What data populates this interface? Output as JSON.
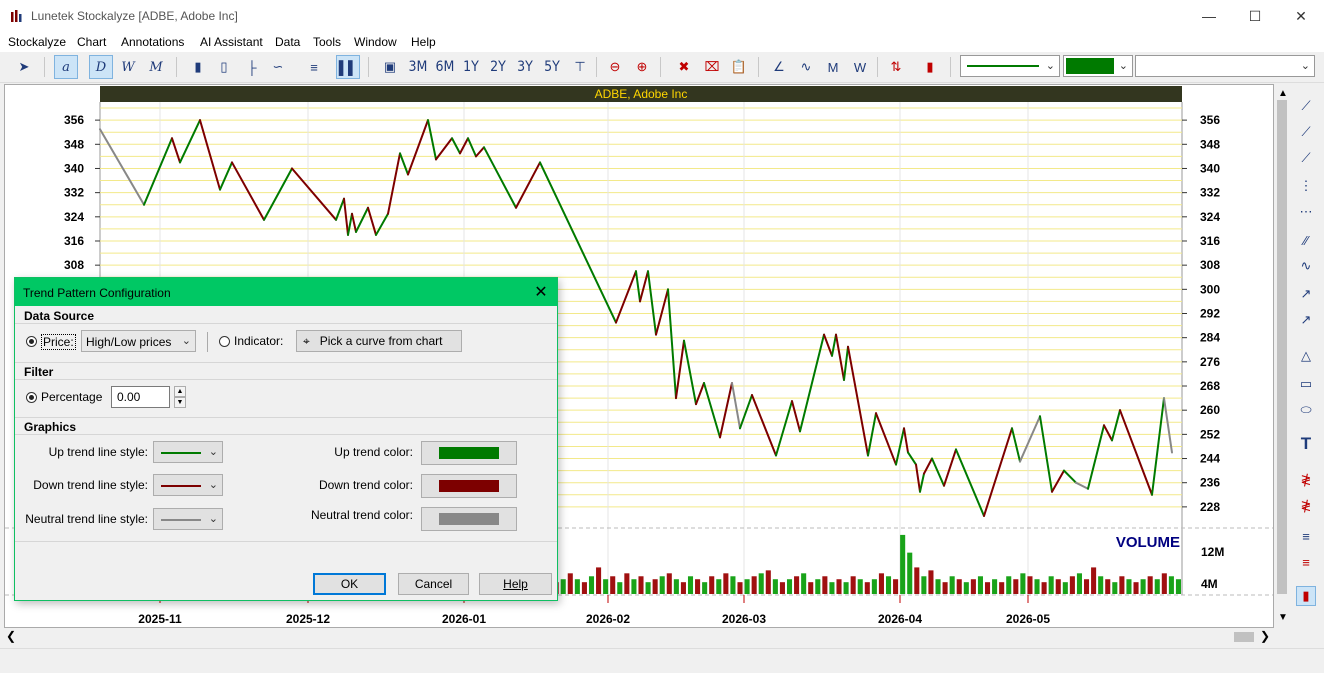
{
  "window": {
    "title": "Lunetek Stockalyze [ADBE, Adobe Inc]"
  },
  "menu": [
    "Stockalyze",
    "Chart",
    "Annotations",
    "AI Assistant",
    "Data",
    "Tools",
    "Window",
    "Help"
  ],
  "toolbar": {
    "periods": [
      "3M",
      "6M",
      "1Y",
      "2Y",
      "3Y",
      "5Y"
    ]
  },
  "chart_data": {
    "type": "line",
    "title": "ADBE, Adobe Inc",
    "ylim": [
      222,
      362
    ],
    "yticks": [
      356,
      348,
      340,
      332,
      324,
      316,
      308,
      300,
      292,
      284,
      276,
      268,
      260,
      252,
      244,
      236,
      228
    ],
    "xlabels": [
      "2025-11",
      "2025-12",
      "2026-01",
      "2026-02",
      "2026-03",
      "2026-04",
      "2026-05"
    ],
    "x_tick_positions_days": [
      15,
      52,
      91,
      127,
      161,
      200,
      232
    ],
    "volume_label": "VOLUME",
    "volume_ticks": [
      "12M",
      "4M"
    ],
    "volume_ylim": [
      0,
      22
    ],
    "trend_points": [
      [
        0,
        353
      ],
      [
        11,
        328
      ],
      [
        18,
        350
      ],
      [
        20,
        342
      ],
      [
        25,
        356
      ],
      [
        30,
        333
      ],
      [
        33,
        342
      ],
      [
        41,
        323
      ],
      [
        48,
        340
      ],
      [
        59,
        323
      ],
      [
        61,
        330
      ],
      [
        62,
        318
      ],
      [
        63,
        325
      ],
      [
        64,
        319
      ],
      [
        67,
        327
      ],
      [
        69,
        318
      ],
      [
        72,
        325
      ],
      [
        75,
        345
      ],
      [
        77,
        338
      ],
      [
        82,
        356
      ],
      [
        84,
        343
      ],
      [
        88,
        350
      ],
      [
        90,
        345
      ],
      [
        92,
        350
      ],
      [
        94,
        344
      ],
      [
        96,
        347
      ],
      [
        104,
        327
      ],
      [
        110,
        342
      ],
      [
        129,
        289
      ],
      [
        134,
        306
      ],
      [
        135,
        296
      ],
      [
        137,
        306
      ],
      [
        139,
        285
      ],
      [
        142,
        300
      ],
      [
        144,
        264
      ],
      [
        146,
        283
      ],
      [
        149,
        262
      ],
      [
        151,
        269
      ],
      [
        155,
        251
      ],
      [
        158,
        269
      ],
      [
        160,
        254
      ],
      [
        163,
        265
      ],
      [
        169,
        245
      ],
      [
        173,
        263
      ],
      [
        175,
        253
      ],
      [
        181,
        285
      ],
      [
        183,
        278
      ],
      [
        184,
        285
      ],
      [
        186,
        270
      ],
      [
        187,
        281
      ],
      [
        192,
        245
      ],
      [
        194,
        259
      ],
      [
        199,
        242
      ],
      [
        201,
        254
      ],
      [
        202,
        246
      ],
      [
        204,
        242
      ],
      [
        205,
        233
      ],
      [
        206,
        239
      ],
      [
        208,
        244
      ],
      [
        211,
        235
      ],
      [
        214,
        247
      ],
      [
        221,
        225
      ],
      [
        228,
        254
      ],
      [
        230,
        243
      ],
      [
        235,
        258
      ],
      [
        238,
        233
      ],
      [
        241,
        240
      ],
      [
        244,
        236
      ],
      [
        247,
        234
      ],
      [
        251,
        255
      ],
      [
        253,
        250
      ],
      [
        255,
        260
      ],
      [
        263,
        232
      ],
      [
        266,
        264
      ],
      [
        268,
        246
      ]
    ],
    "trend_colors": [
      "neutral",
      "up",
      "down",
      "up",
      "down",
      "up",
      "down",
      "up",
      "down",
      "up",
      "down",
      "up",
      "down",
      "up",
      "down",
      "up",
      "down",
      "up",
      "down",
      "up",
      "down",
      "up",
      "down",
      "up",
      "down",
      "up",
      "down",
      "up",
      "down",
      "up",
      "down",
      "up",
      "down",
      "up",
      "down",
      "up",
      "down",
      "up",
      "down",
      "neutral",
      "up",
      "down",
      "up",
      "down",
      "up",
      "down",
      "up",
      "down",
      "up",
      "down",
      "up",
      "down",
      "up",
      "down",
      "up",
      "down",
      "up",
      "down",
      "up",
      "down",
      "up",
      "down",
      "up",
      "neutral",
      "up",
      "down",
      "up",
      "neutral",
      "up",
      "down",
      "up",
      "down",
      "up",
      "neutral",
      "up",
      "neutral"
    ],
    "volume": [
      6,
      5,
      7,
      4,
      6,
      5,
      8,
      6,
      5,
      7,
      4,
      6,
      5,
      9,
      6,
      5,
      7,
      5,
      6,
      4,
      8,
      6,
      5,
      7,
      6,
      5,
      4,
      6,
      5,
      7,
      8,
      5,
      6,
      4,
      5,
      7,
      6,
      5,
      6,
      4,
      5,
      6,
      7,
      5,
      4,
      6,
      5,
      7,
      6,
      5,
      4,
      6,
      5,
      6,
      4,
      5,
      7,
      6,
      5,
      4,
      6,
      8,
      5,
      6,
      4,
      5,
      7,
      5,
      4,
      6,
      9,
      5,
      6,
      4,
      7,
      5,
      6,
      4,
      5,
      6,
      7,
      5,
      4,
      6,
      5,
      4,
      6,
      5,
      7,
      6,
      4,
      5,
      6,
      7,
      8,
      5,
      4,
      5,
      6,
      7,
      4,
      5,
      6,
      4,
      5,
      4,
      6,
      5,
      4,
      5,
      7,
      6,
      5,
      20,
      14,
      9,
      6,
      8,
      5,
      4,
      6,
      5,
      4,
      5,
      6,
      4,
      5,
      4,
      6,
      5,
      7,
      6,
      5,
      4,
      6,
      5,
      4,
      6,
      7,
      5,
      9,
      6,
      5,
      4,
      6,
      5,
      4,
      5,
      6,
      5,
      7,
      6,
      5
    ],
    "volume_colors": [
      "up",
      "down",
      "up",
      "up",
      "down",
      "up",
      "down",
      "up",
      "down",
      "up",
      "down",
      "up",
      "down",
      "down",
      "up",
      "up",
      "down",
      "up",
      "down",
      "up",
      "down",
      "up",
      "down",
      "down",
      "up",
      "down",
      "up",
      "down",
      "up",
      "down",
      "up",
      "up",
      "down",
      "up",
      "down",
      "up",
      "down",
      "up",
      "down",
      "up",
      "down",
      "up",
      "down",
      "up",
      "down",
      "up",
      "down",
      "up",
      "down",
      "up",
      "down",
      "up",
      "down",
      "up",
      "down",
      "up",
      "down",
      "up",
      "down",
      "up",
      "down",
      "up",
      "down",
      "up",
      "down",
      "up",
      "down",
      "up",
      "down",
      "up",
      "down",
      "up",
      "down",
      "up",
      "down",
      "up",
      "down",
      "up",
      "down",
      "up",
      "down",
      "up",
      "down",
      "up",
      "down",
      "up",
      "down",
      "up",
      "down",
      "up",
      "down",
      "up",
      "down",
      "up",
      "down",
      "up",
      "down",
      "up",
      "down",
      "up",
      "down",
      "up",
      "down",
      "up",
      "down",
      "up",
      "down",
      "up",
      "down",
      "up",
      "down",
      "up",
      "down",
      "up",
      "up",
      "down",
      "up",
      "down",
      "up",
      "down",
      "up",
      "down",
      "up",
      "down",
      "up",
      "down",
      "up",
      "down",
      "up",
      "down",
      "up",
      "down",
      "up",
      "down",
      "up",
      "down",
      "up",
      "down",
      "up",
      "down",
      "down",
      "up",
      "down",
      "up",
      "down",
      "up",
      "down",
      "up",
      "down",
      "up",
      "down",
      "up",
      "up"
    ]
  },
  "colors": {
    "up": "#007a00",
    "down": "#7d0000",
    "neutral": "#888888",
    "accent": "#00c864"
  },
  "dialog": {
    "title": "Trend Pattern Configuration",
    "data_source_label": "Data Source",
    "price_label": "Price:",
    "price_select_value": "High/Low prices",
    "indicator_label": "Indicator:",
    "pick_curve_label": "Pick a curve from chart",
    "filter_label": "Filter",
    "percentage_label": "Percentage",
    "percentage_value": "0.00",
    "graphics_label": "Graphics",
    "up_style_label": "Up trend line style:",
    "down_style_label": "Down trend line style:",
    "neutral_style_label": "Neutral trend line style:",
    "up_color_label": "Up trend color:",
    "down_color_label": "Down trend color:",
    "neutral_color_label": "Neutral trend color:",
    "ok_label": "OK",
    "cancel_label": "Cancel",
    "help_label": "Help"
  }
}
